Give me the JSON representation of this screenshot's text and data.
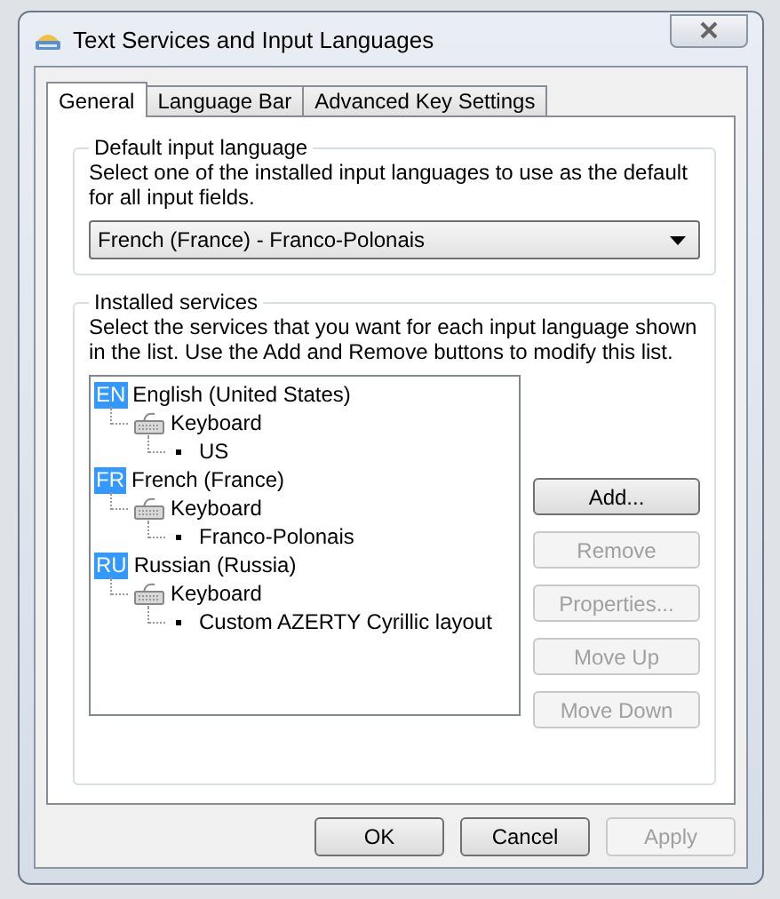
{
  "window": {
    "title": "Text Services and Input Languages"
  },
  "tabs": [
    {
      "label": "General",
      "selected": true
    },
    {
      "label": "Language Bar",
      "selected": false
    },
    {
      "label": "Advanced Key Settings",
      "selected": false
    }
  ],
  "default_input_language": {
    "title": "Default input language",
    "description": "Select one of the installed input languages to use as the default for all input fields.",
    "dropdown": {
      "value": "French (France) - Franco-Polonais"
    }
  },
  "installed_services": {
    "title": "Installed services",
    "description": "Select the services that you want for each input language shown in the list. Use the Add and Remove buttons to modify this list.",
    "tree": [
      {
        "code": "EN",
        "label": "English (United States)",
        "children": [
          {
            "label": "Keyboard",
            "children": [
              {
                "label": "US"
              }
            ]
          }
        ]
      },
      {
        "code": "FR",
        "label": "French (France)",
        "children": [
          {
            "label": "Keyboard",
            "children": [
              {
                "label": "Franco-Polonais"
              }
            ]
          }
        ]
      },
      {
        "code": "RU",
        "label": "Russian (Russia)",
        "children": [
          {
            "label": "Keyboard",
            "children": [
              {
                "label": "Custom AZERTY Cyrillic layout"
              }
            ]
          }
        ]
      }
    ],
    "buttons": [
      {
        "label": "Add...",
        "disabled": false
      },
      {
        "label": "Remove",
        "disabled": true
      },
      {
        "label": "Properties...",
        "disabled": true
      },
      {
        "label": "Move Up",
        "disabled": true
      },
      {
        "label": "Move Down",
        "disabled": true
      }
    ]
  },
  "buttons": [
    {
      "label": "OK",
      "disabled": false
    },
    {
      "label": "Cancel",
      "disabled": false
    },
    {
      "label": "Apply",
      "disabled": true
    }
  ]
}
